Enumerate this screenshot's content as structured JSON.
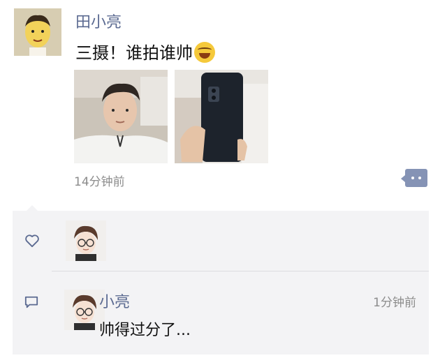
{
  "post": {
    "author": "田小亮",
    "content": "三摄！谁拍谁帅",
    "emoji_icon": "laughing-tears-emoji",
    "timestamp": "14分钟前",
    "comment_button_icon": "comment-more-icon"
  },
  "interactions": {
    "like_icon": "heart-icon",
    "comment_icon": "comment-icon",
    "comment": {
      "author": "小亮",
      "time": "1分钟前",
      "text": "帅得过分了..."
    }
  },
  "colors": {
    "name_blue": "#5b6a91",
    "panel_bg": "#f3f3f5",
    "button_bg": "#8593b5",
    "meta_gray": "#8c8c8c"
  }
}
